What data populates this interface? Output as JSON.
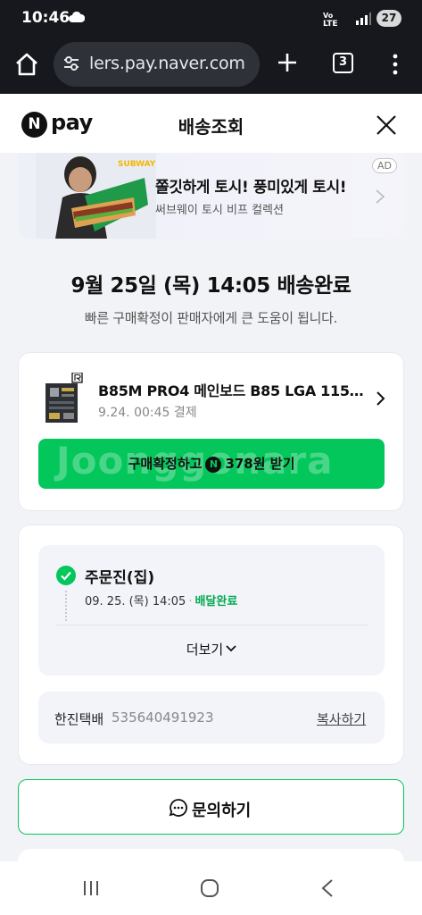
{
  "status_bar": {
    "time": "10:46",
    "network": "LTE",
    "battery": "27"
  },
  "browser": {
    "url": "lers.pay.naver.com",
    "tab_count": "3"
  },
  "header": {
    "logo_badge": "N",
    "logo_text": "pay",
    "title": "배송조회"
  },
  "ad": {
    "brand": "SUBWAY",
    "headline": "쫄깃하게 토시! 풍미있게 토시!",
    "subtext": "써브웨이 토시 비프 컬렉션",
    "badge": "AD"
  },
  "delivery": {
    "status_title": "9월 25일 (목) 14:05 배송완료",
    "status_sub": "빠른 구매확정이 판매자에게 큰 도움이 됩니다."
  },
  "product": {
    "name": "B85M PRO4 메인보드 B85 LGA 1150 ...",
    "paid_date": "9.24. 00:45 결제",
    "confirm_label_pre": "구매확정하고",
    "confirm_label_post": "378원 받기",
    "confirm_icon": "N",
    "watermark": "Joonggonara"
  },
  "tracking": {
    "location": "주문진(집)",
    "time": "09. 25. (목) 14:05",
    "separator": "·",
    "status": "배달완료",
    "more_label": "더보기",
    "courier_name": "한진택배",
    "tracking_number": "535640491923",
    "copy_label": "복사하기"
  },
  "inquiry": {
    "label": "문의하기"
  },
  "colors": {
    "accent": "#03c75a",
    "dark_bar": "#16181d",
    "background": "#f2f3f6"
  }
}
